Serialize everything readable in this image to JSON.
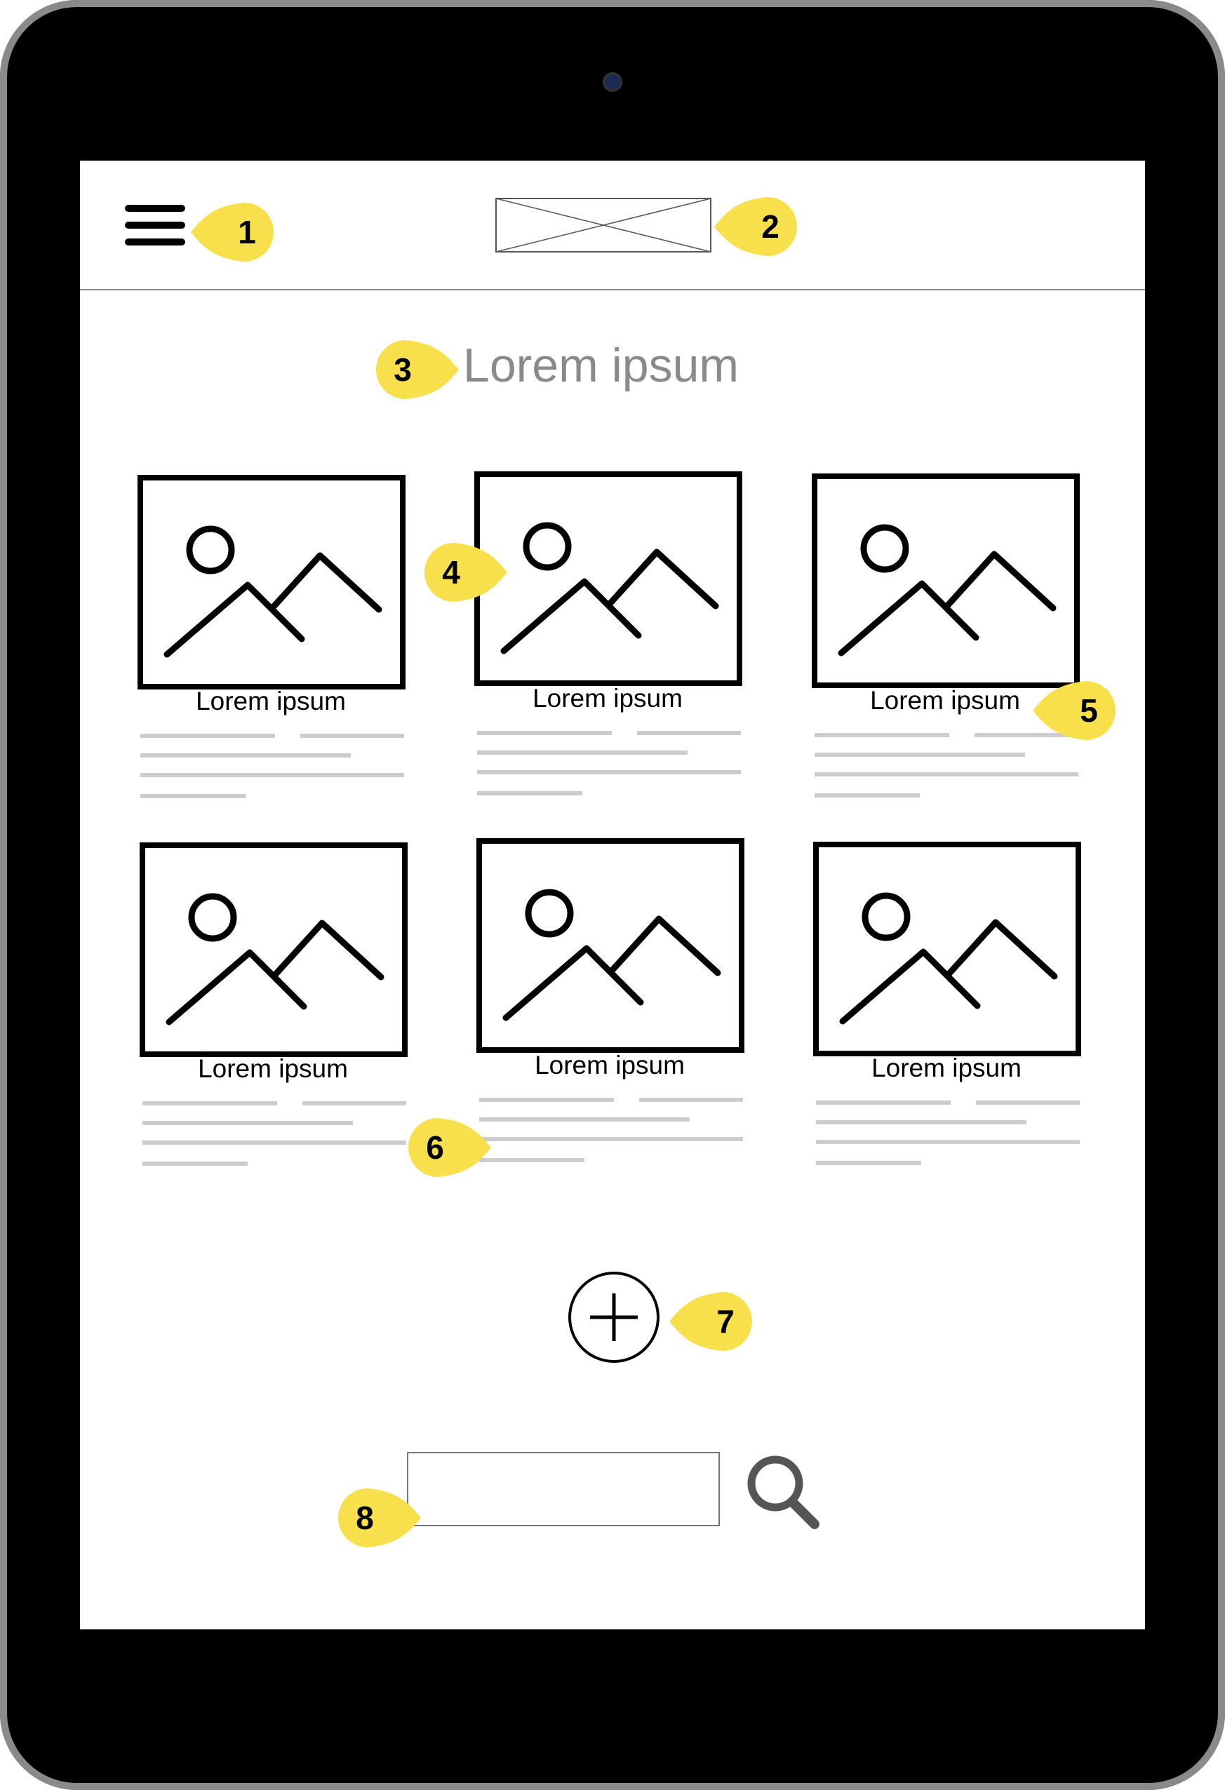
{
  "header": {
    "menu_icon": "hamburger-menu-icon",
    "logo_icon": "logo-placeholder-icon"
  },
  "page": {
    "title": "Lorem ipsum"
  },
  "cards": [
    {
      "title": "Lorem ipsum",
      "image_icon": "image-placeholder-icon"
    },
    {
      "title": "Lorem ipsum",
      "image_icon": "image-placeholder-icon"
    },
    {
      "title": "Lorem ipsum",
      "image_icon": "image-placeholder-icon"
    },
    {
      "title": "Lorem ipsum",
      "image_icon": "image-placeholder-icon"
    },
    {
      "title": "Lorem ipsum",
      "image_icon": "image-placeholder-icon"
    },
    {
      "title": "Lorem ipsum",
      "image_icon": "image-placeholder-icon"
    }
  ],
  "add_button": {
    "icon": "plus-icon"
  },
  "search": {
    "value": "",
    "placeholder": "",
    "icon": "search-icon"
  },
  "callouts": [
    "1",
    "2",
    "3",
    "4",
    "5",
    "6",
    "7",
    "8"
  ],
  "colors": {
    "callout": "#f7e04b",
    "bezel": "#000000",
    "frame": "#8a8a8a",
    "title_text": "#8a8a8a",
    "placeholder_line": "#cccccc",
    "search_icon": "#555555"
  }
}
